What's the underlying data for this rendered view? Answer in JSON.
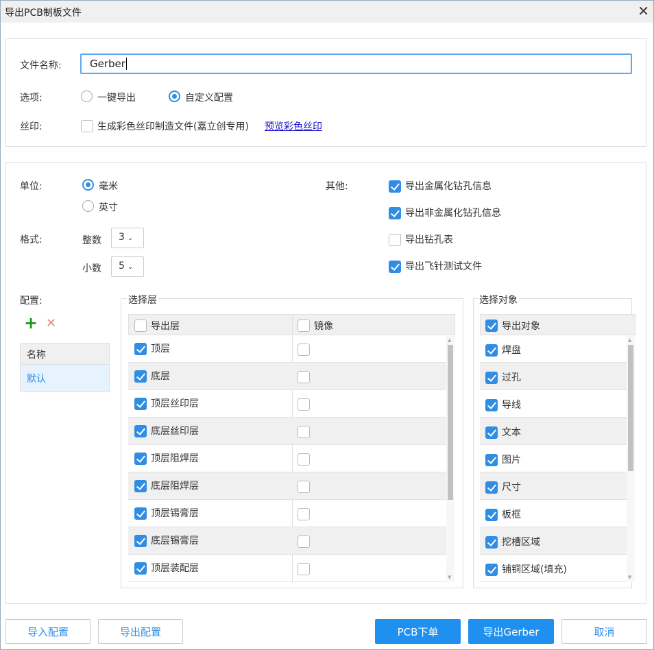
{
  "window": {
    "title": "导出PCB制板文件",
    "close": "✕"
  },
  "top": {
    "filename_label": "文件名称:",
    "filename_value": "Gerber",
    "options_label": "选项:",
    "option_one_click": "一键导出",
    "option_custom": "自定义配置",
    "option_selected": "custom",
    "silk_label": "丝印:",
    "silk_checkbox": "生成彩色丝印制造文件(嘉立创专用)",
    "silk_checked": false,
    "silk_link": "预览彩色丝印"
  },
  "settings": {
    "unit_label": "单位:",
    "unit_mm": "毫米",
    "unit_inch": "英寸",
    "unit_selected": "mm",
    "format_label": "格式:",
    "integer_label": "整数",
    "integer_value": "3",
    "decimal_label": "小数",
    "decimal_value": "5",
    "other_label": "其他:",
    "other_options": [
      {
        "label": "导出金属化钻孔信息",
        "checked": true
      },
      {
        "label": "导出非金属化钻孔信息",
        "checked": true
      },
      {
        "label": "导出钻孔表",
        "checked": false
      },
      {
        "label": "导出飞针测试文件",
        "checked": true
      }
    ],
    "config_label": "配置:",
    "config_header": "名称",
    "config_items": [
      "默认"
    ]
  },
  "layers": {
    "legend": "选择层",
    "col_export": "导出层",
    "col_mirror": "镜像",
    "rows": [
      {
        "name": "顶层",
        "export": true,
        "mirror": false
      },
      {
        "name": "底层",
        "export": true,
        "mirror": false
      },
      {
        "name": "顶层丝印层",
        "export": true,
        "mirror": false
      },
      {
        "name": "底层丝印层",
        "export": true,
        "mirror": false
      },
      {
        "name": "顶层阻焊层",
        "export": true,
        "mirror": false
      },
      {
        "name": "底层阻焊层",
        "export": true,
        "mirror": false
      },
      {
        "name": "顶层锡膏层",
        "export": true,
        "mirror": false
      },
      {
        "name": "底层锡膏层",
        "export": true,
        "mirror": false
      },
      {
        "name": "顶层装配层",
        "export": true,
        "mirror": false
      }
    ]
  },
  "objects": {
    "legend": "选择对象",
    "col_export": "导出对象",
    "header_checked": true,
    "rows": [
      {
        "name": "焊盘",
        "checked": true
      },
      {
        "name": "过孔",
        "checked": true
      },
      {
        "name": "导线",
        "checked": true
      },
      {
        "name": "文本",
        "checked": true
      },
      {
        "name": "图片",
        "checked": true
      },
      {
        "name": "尺寸",
        "checked": true
      },
      {
        "name": "板框",
        "checked": true
      },
      {
        "name": "挖槽区域",
        "checked": true
      },
      {
        "name": "铺铜区域(填充)",
        "checked": true
      }
    ]
  },
  "buttons": {
    "import_config": "导入配置",
    "export_config": "导出配置",
    "pcb_order": "PCB下单",
    "export_gerber": "导出Gerber",
    "cancel": "取消"
  },
  "colors": {
    "accent": "#2f8de4",
    "button_blue": "#1f8ff0",
    "link": "#1a0dcc"
  }
}
